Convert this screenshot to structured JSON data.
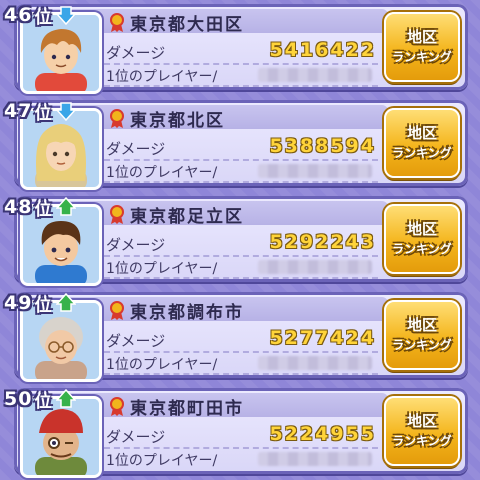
{
  "ranking": {
    "entries": [
      {
        "rank": "46",
        "rank_suffix": "位",
        "trend": "down",
        "trend_icon": "arrow-down-icon",
        "region": "東京都大田区",
        "damage_label": "ダメージ",
        "damage": "5416422",
        "top_player_label": "1位のプレイヤー/",
        "button_line1": "地区",
        "button_line2": "ランキング",
        "avatar_hair": "#c2772f",
        "avatar_skin": "#f6d0a8",
        "avatar_shirt": "#e24a3b"
      },
      {
        "rank": "47",
        "rank_suffix": "位",
        "trend": "down",
        "trend_icon": "arrow-down-icon",
        "region": "東京都北区",
        "damage_label": "ダメージ",
        "damage": "5388594",
        "top_player_label": "1位のプレイヤー/",
        "button_line1": "地区",
        "button_line2": "ランキング",
        "avatar_hair": "#e9cf7a",
        "avatar_skin": "#f7d6b5",
        "avatar_shirt": "#d8c69a"
      },
      {
        "rank": "48",
        "rank_suffix": "位",
        "trend": "up",
        "trend_icon": "arrow-up-icon",
        "region": "東京都足立区",
        "damage_label": "ダメージ",
        "damage": "5292243",
        "top_player_label": "1位のプレイヤー/",
        "button_line1": "地区",
        "button_line2": "ランキング",
        "avatar_hair": "#5a3318",
        "avatar_skin": "#f4c9a0",
        "avatar_shirt": "#2f7ad0"
      },
      {
        "rank": "49",
        "rank_suffix": "位",
        "trend": "up",
        "trend_icon": "arrow-up-icon",
        "region": "東京都調布市",
        "damage_label": "ダメージ",
        "damage": "5277424",
        "top_player_label": "1位のプレイヤー/",
        "button_line1": "地区",
        "button_line2": "ランキング",
        "avatar_hair": "#d8d3cc",
        "avatar_skin": "#f1c9a6",
        "avatar_shirt": "#c9a38a"
      },
      {
        "rank": "50",
        "rank_suffix": "位",
        "trend": "up",
        "trend_icon": "arrow-up-icon",
        "region": "東京都町田市",
        "damage_label": "ダメージ",
        "damage": "5224955",
        "top_player_label": "1位のプレイヤー/",
        "button_line1": "地区",
        "button_line2": "ランキング",
        "avatar_hair": "#c9332b",
        "avatar_skin": "#e3b48a",
        "avatar_shirt": "#6e8a3c"
      }
    ]
  },
  "colors": {
    "background": "#8f86d8",
    "trend_down": "#3aa6e8",
    "trend_up": "#37b24a",
    "damage_value": "#ffd43a",
    "button": "#f4b51c",
    "medal": "#d83a2e"
  }
}
